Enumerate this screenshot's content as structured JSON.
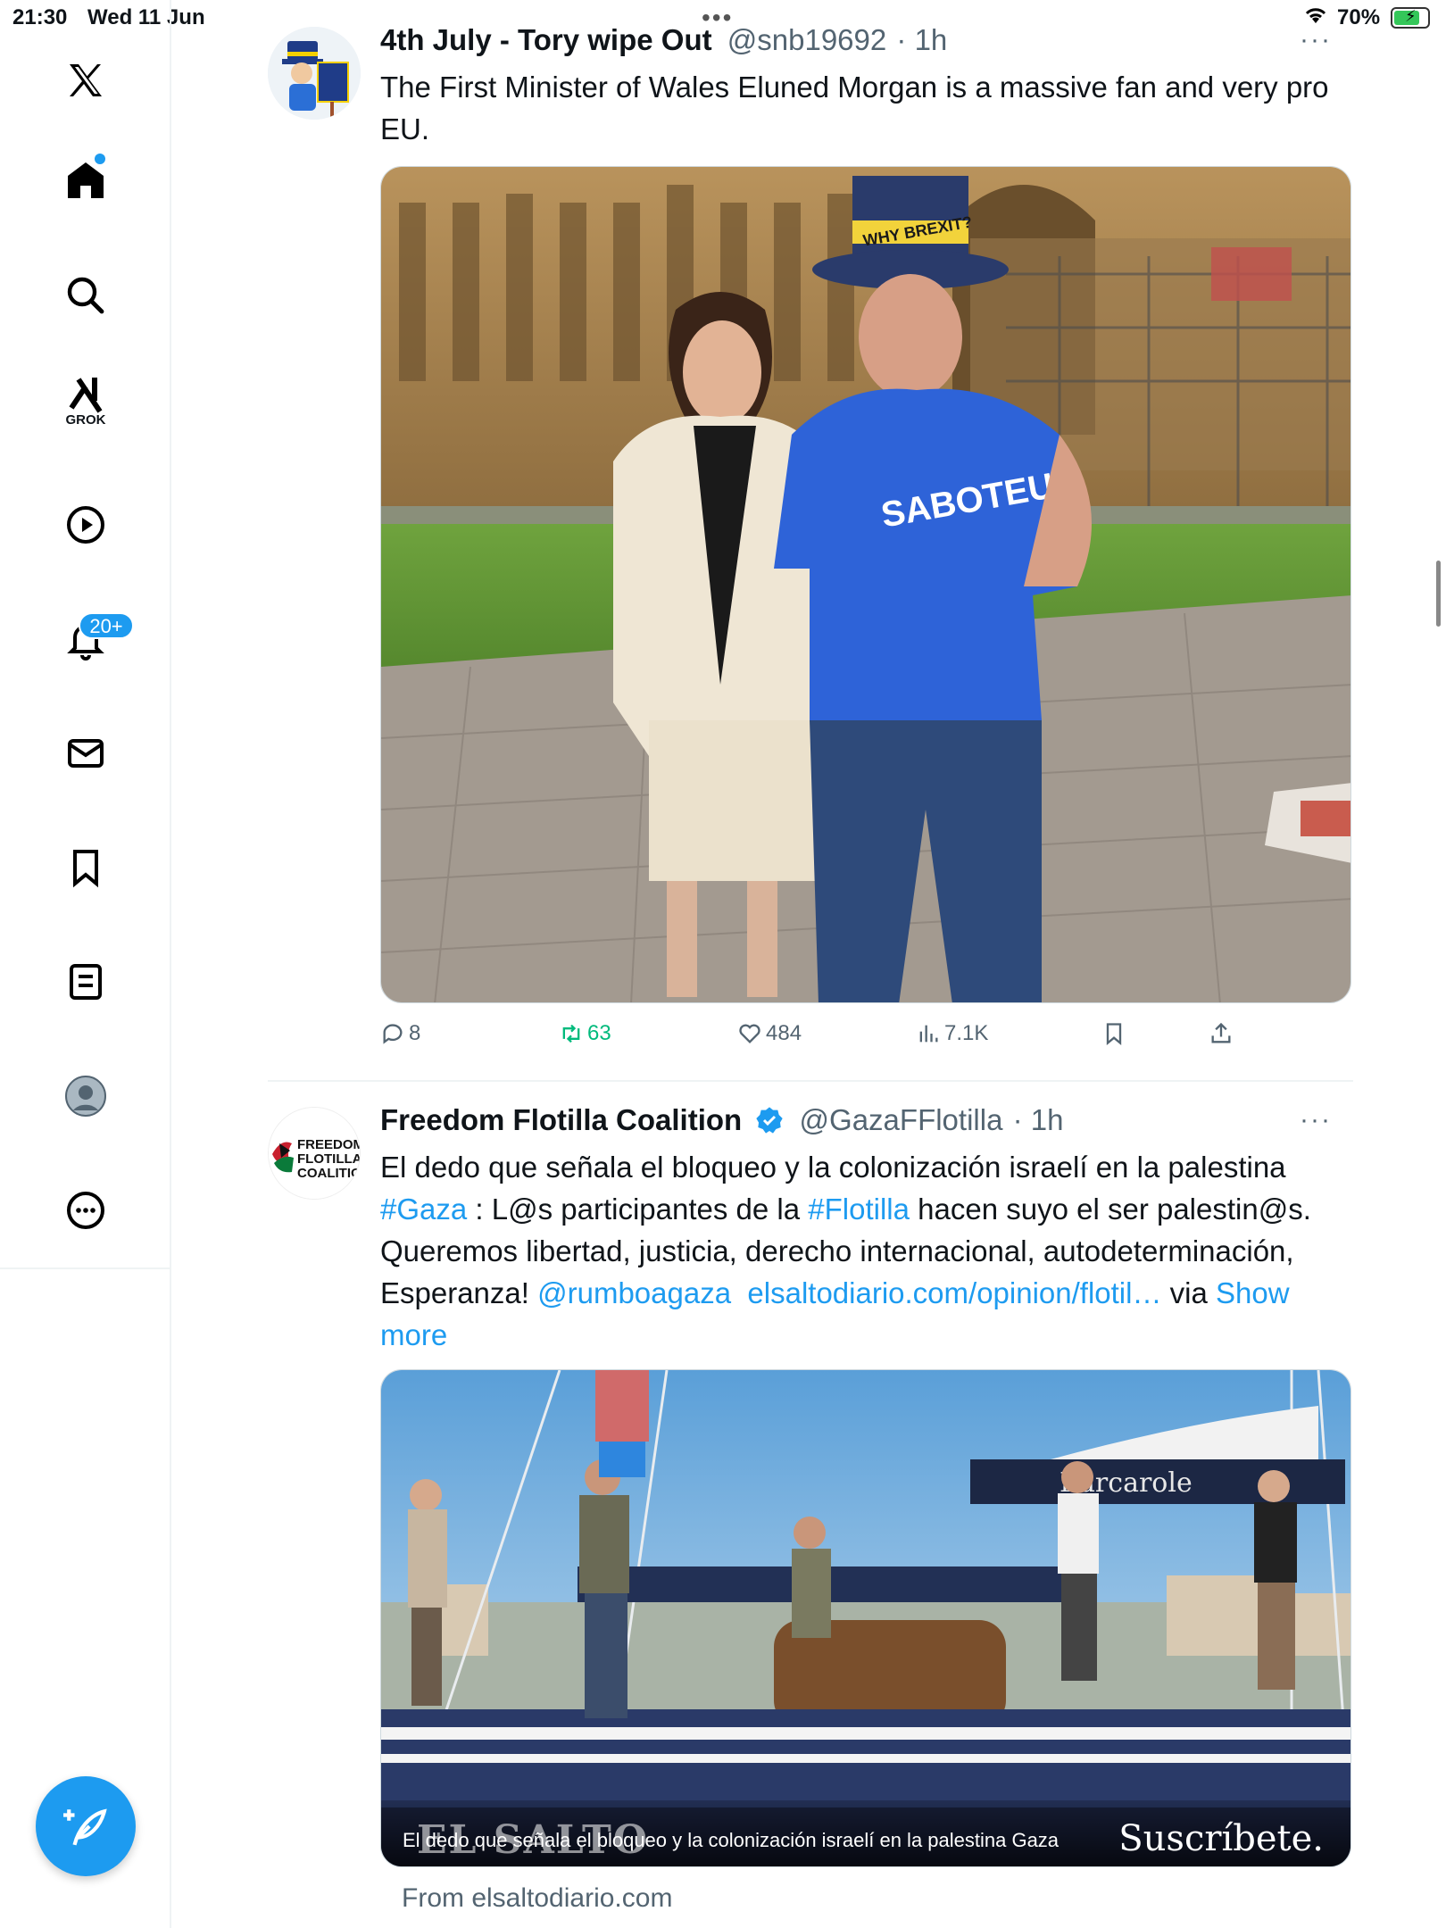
{
  "status_bar": {
    "time": "21:30",
    "date": "Wed 11 Jun",
    "battery": "70%"
  },
  "sidebar": {
    "grok_label": "GROK",
    "notifications_badge": "20+",
    "items": [
      {
        "name": "x-logo-icon"
      },
      {
        "name": "home-icon"
      },
      {
        "name": "search-icon"
      },
      {
        "name": "grok-icon"
      },
      {
        "name": "video-icon"
      },
      {
        "name": "bell-icon"
      },
      {
        "name": "mail-icon"
      },
      {
        "name": "bookmark-icon"
      },
      {
        "name": "lists-icon"
      },
      {
        "name": "profile-icon"
      },
      {
        "name": "more-icon"
      }
    ],
    "accent": "#1d9bf0"
  },
  "tweets": [
    {
      "name": "4th July - Tory wipe Out",
      "handle": "@snb19692",
      "time": "· 1h",
      "text": "The First Minister of Wales Eluned Morgan is a massive fan and very pro EU.",
      "replies": "8",
      "retweets": "63",
      "likes": "484",
      "views": "7.1K",
      "image_hat_text": "WHY BREXIT?",
      "image_shirt_text": "SABOTEUR"
    },
    {
      "name": "Freedom Flotilla Coalition",
      "handle": "@GazaFFlotilla",
      "time": "· 1h",
      "avatar_text": "FREEDOM FLOTILLA COALITION",
      "text_line1": "El dedo que señala el bloqueo y la colonización israelí en la palestina",
      "tag_gaza": "#Gaza",
      "text_line2a": " : L@s participantes de la ",
      "tag_flotilla": "#Flotilla",
      "text_line2b": " hacen suyo el ser palestin@s.",
      "text_line3": "Queremos libertad, justicia, derecho internacional, autodeterminación,",
      "text_line4a": "Esperanza! ",
      "mention": "@rumboagaza",
      "link": "elsaltodiario.com/opinion/flotil…",
      "via": " via ",
      "show_more": "Show more",
      "image_caption": "El dedo que señala el bloqueo y la colonización israelí en la palestina Gaza",
      "image_brand": "Suscríbete.",
      "image_watermark": "EL SALTO",
      "boat_name": "Barcarole",
      "from": "From elsaltodiario.com"
    }
  ]
}
